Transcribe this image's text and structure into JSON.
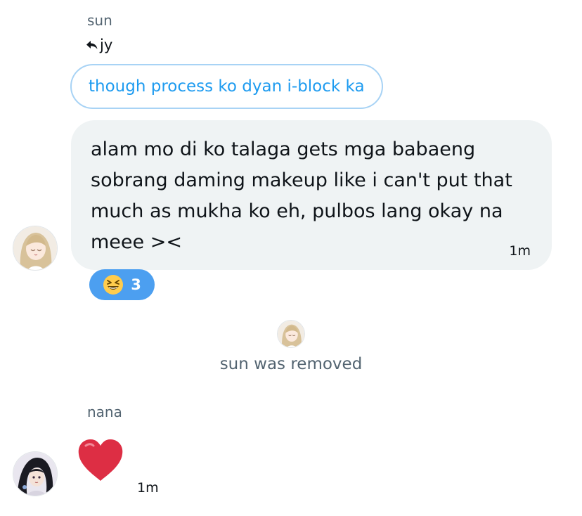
{
  "conversation": {
    "messages": [
      {
        "sender": "sun",
        "reply_to": "jy",
        "quoted_text": "though process ko dyan i-block ka",
        "text": "alam mo di ko talaga gets mga babaeng sobrang daming makeup like i can't put that much as mukha ko eh, pulbos lang okay na meee ><",
        "time": "1m",
        "reaction": {
          "emoji_icon": "grinning-squinting-face-icon",
          "count": "3"
        }
      },
      {
        "sender": "nana",
        "content_icon": "red-heart-icon",
        "time": "1m"
      }
    ],
    "system_event": {
      "text": "sun was removed"
    }
  },
  "colors": {
    "accent": "#1d9bf0",
    "reaction_bg": "#4c9ff0",
    "bubble_bg": "#eff3f4",
    "secondary_text": "#536471"
  }
}
